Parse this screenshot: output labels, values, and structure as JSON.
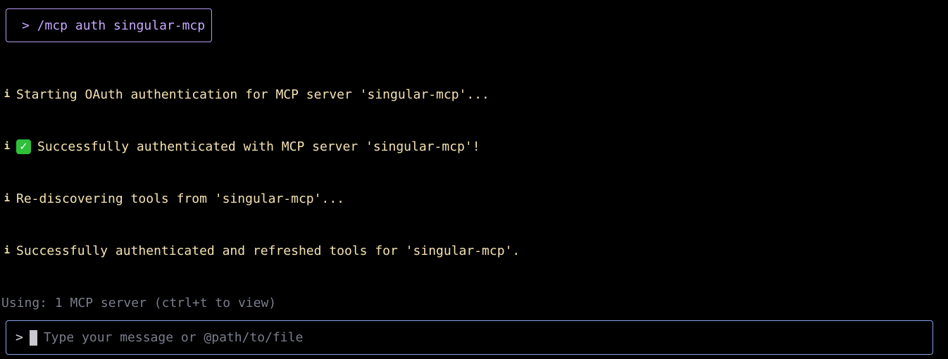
{
  "command": {
    "text": "> /mcp auth singular-mcp"
  },
  "log": [
    {
      "icon": "i",
      "text": "Starting OAuth authentication for MCP server 'singular-mcp'..."
    },
    {
      "icon": "i",
      "check": "✓",
      "text": "Successfully authenticated with MCP server 'singular-mcp'!"
    },
    {
      "icon": "i",
      "text": "Re-discovering tools from 'singular-mcp'..."
    },
    {
      "icon": "i",
      "text": "Successfully authenticated and refreshed tools for 'singular-mcp'."
    }
  ],
  "status": {
    "text": "Using: 1 MCP server (ctrl+t to view)"
  },
  "input": {
    "prompt": ">",
    "placeholder": "Type your message or @path/to/file",
    "value": ""
  },
  "colors": {
    "command_border": "#b79bf0",
    "log_text": "#f3e2b0",
    "status_text": "#7a7d8c",
    "input_border": "#8aa3e8",
    "check_bg": "#2fbf3a"
  }
}
